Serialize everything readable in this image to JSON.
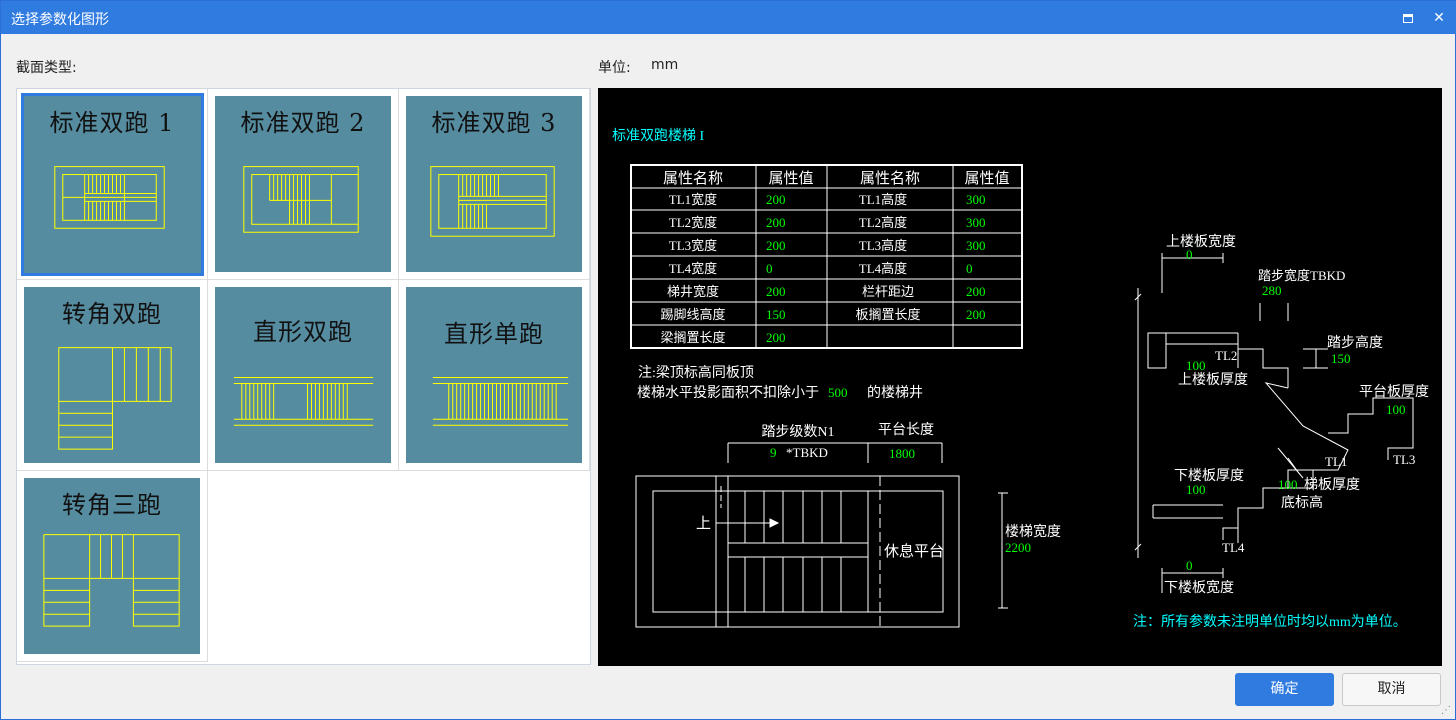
{
  "window": {
    "title": "选择参数化图形"
  },
  "section_label": "截面类型:",
  "unit": {
    "label": "单位:",
    "value": "mm"
  },
  "thumbnails": [
    {
      "name": "标准双跑 1",
      "selected": true
    },
    {
      "name": "标准双跑 2",
      "selected": false
    },
    {
      "name": "标准双跑 3",
      "selected": false
    },
    {
      "name": "转角双跑",
      "selected": false
    },
    {
      "name": "直形双跑",
      "selected": false
    },
    {
      "name": "直形单跑",
      "selected": false
    },
    {
      "name": "转角三跑",
      "selected": false
    }
  ],
  "preview": {
    "title": "标准双跑楼梯 I",
    "table": {
      "headers": [
        "属性名称",
        "属性值",
        "属性名称",
        "属性值"
      ],
      "rows": [
        [
          "TL1宽度",
          "200",
          "TL1高度",
          "300"
        ],
        [
          "TL2宽度",
          "200",
          "TL2高度",
          "300"
        ],
        [
          "TL3宽度",
          "200",
          "TL3高度",
          "300"
        ],
        [
          "TL4宽度",
          "0",
          "TL4高度",
          "0"
        ],
        [
          "梯井宽度",
          "200",
          "栏杆距边",
          "200"
        ],
        [
          "踢脚线高度",
          "150",
          "板搁置长度",
          "200"
        ],
        [
          "梁搁置长度",
          "200",
          "",
          ""
        ]
      ]
    },
    "note1": "注:梁顶标高同板顶",
    "note2_prefix": "楼梯水平投影面积不扣除小于",
    "note2_value": "500",
    "note2_suffix": "的楼梯井",
    "plan": {
      "steps_label": "踏步级数N1",
      "steps_value": "9",
      "steps_suffix": "*TBKD",
      "platform_label": "平台长度",
      "platform_value": "1800",
      "up_label": "上",
      "rest_label": "休息平台",
      "width_label": "楼梯宽度",
      "width_value": "2200"
    },
    "section": {
      "top_slab_w_label": "上楼板宽度",
      "top_slab_w_value": "0",
      "tread_w_label": "踏步宽度TBKD",
      "tread_w_value": "280",
      "riser_h_label": "踏步高度",
      "riser_h_value": "150",
      "top_slab_t_value": "100",
      "top_slab_t_label": "上楼板厚度",
      "platform_t_label": "平台板厚度",
      "platform_t_value": "100",
      "bottom_slab_t_label": "下楼板厚度",
      "bottom_slab_t_value": "100",
      "stair_t_value": "100",
      "stair_t_label": "梯板厚度",
      "base_elev_label": "底标高",
      "bottom_slab_w_value": "0",
      "bottom_slab_w_label": "下楼板宽度",
      "tl1": "TL1",
      "tl2": "TL2",
      "tl3": "TL3",
      "tl4": "TL4"
    },
    "footer_note": "注：所有参数未注明单位时均以mm为单位。"
  },
  "buttons": {
    "ok": "确定",
    "cancel": "取消"
  },
  "colors": {
    "accent": "#2f7be0",
    "thumb_bg": "#558ca0",
    "cad_yellow": "#ffff00",
    "cad_green": "#00ff00",
    "cad_cyan": "#00ffff"
  }
}
